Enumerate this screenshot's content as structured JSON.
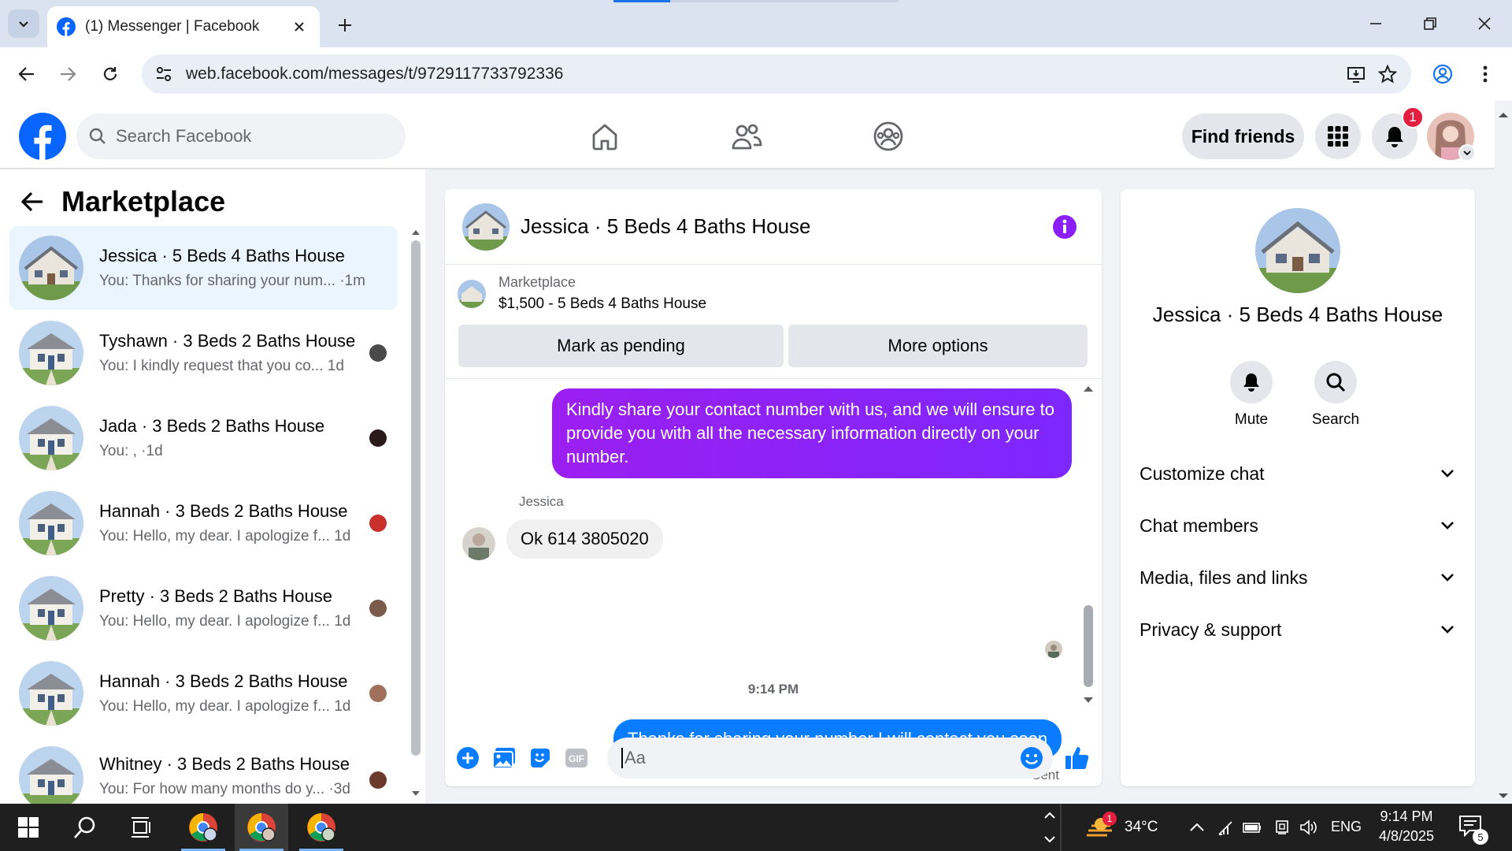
{
  "browser": {
    "tab_title": "(1) Messenger | Facebook",
    "url": "web.facebook.com/messages/t/9729117733792336"
  },
  "fb_header": {
    "search_placeholder": "Search Facebook",
    "find_friends": "Find friends",
    "notification_count": "1",
    "brand_color": "#0866ff"
  },
  "left_panel": {
    "title": "Marketplace",
    "conversations": [
      {
        "name": "Jessica · 5 Beds 4 Baths House",
        "preview": "You: Thanks for sharing your num...",
        "time": "·1m",
        "active": true
      },
      {
        "name": "Tyshawn · 3 Beds 2 Baths House",
        "preview": "You: I kindly request that you co...",
        "time": "1d"
      },
      {
        "name": "Jada · 3 Beds 2 Baths House",
        "preview": "You: , ·",
        "time": "1d"
      },
      {
        "name": "Hannah · 3 Beds 2 Baths House",
        "preview": "You: Hello, my dear. I apologize f...",
        "time": "1d"
      },
      {
        "name": "Pretty · 3 Beds 2 Baths House",
        "preview": "You: Hello, my dear. I apologize f...",
        "time": "1d"
      },
      {
        "name": "Hannah · 3 Beds 2 Baths House",
        "preview": "You: Hello, my dear. I apologize f...",
        "time": "1d"
      },
      {
        "name": "Whitney · 3 Beds 2 Baths House",
        "preview": "You: For how many months do y...",
        "time": "·3d"
      }
    ]
  },
  "chat": {
    "title": "Jessica · 5 Beds 4 Baths House",
    "marketplace_label": "Marketplace",
    "listing": "$1,500 - 5 Beds 4 Baths House",
    "mark_pending": "Mark as pending",
    "more_options": "More options",
    "messages": {
      "out1": "Kindly share your contact number with us, and we will ensure to provide you with all the necessary information directly on your number.",
      "sender": "Jessica",
      "in1": "Ok 614 3805020",
      "timestamp": "9:14 PM",
      "out2": "Thanks for sharing your number I will contact you soon",
      "status": "Sent"
    },
    "composer_placeholder": "Aa"
  },
  "right_panel": {
    "name": "Jessica · 5 Beds 4 Baths House",
    "mute": "Mute",
    "search": "Search",
    "sections": [
      "Customize chat",
      "Chat members",
      "Media, files and links",
      "Privacy & support"
    ]
  },
  "taskbar": {
    "temperature": "34°C",
    "weather_badge": "1",
    "language": "ENG",
    "time": "9:14 PM",
    "date": "4/8/2025",
    "notifications": "5"
  }
}
